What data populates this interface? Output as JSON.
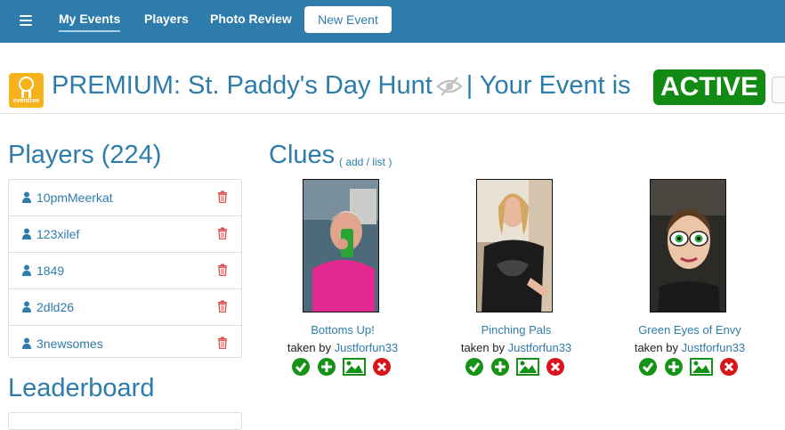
{
  "nav": {
    "items": [
      {
        "label": "My Events",
        "active": true
      },
      {
        "label": "Players",
        "active": false
      },
      {
        "label": "Photo Review",
        "active": false
      }
    ],
    "new_event_label": "New Event"
  },
  "header": {
    "logo_text": "eventzee",
    "title_prefix": "PREMIUM: St. Paddy's Day Hunt",
    "title_suffix": "| Your Event is",
    "status": "ACTIVE"
  },
  "players": {
    "heading": "Players (224)",
    "items": [
      {
        "name": "10pmMeerkat"
      },
      {
        "name": "123xilef"
      },
      {
        "name": "1849"
      },
      {
        "name": "2dld26"
      },
      {
        "name": "3newsomes"
      }
    ]
  },
  "clues": {
    "heading": "Clues",
    "sub_links": "( add / list )",
    "items": [
      {
        "title": "Bottoms Up!",
        "taken_prefix": "taken by",
        "user": "Justforfun33"
      },
      {
        "title": "Pinching Pals",
        "taken_prefix": "taken by",
        "user": "Justforfun33"
      },
      {
        "title": "Green Eyes of Envy",
        "taken_prefix": "taken by",
        "user": "Justforfun33"
      }
    ]
  },
  "leaderboard": {
    "heading": "Leaderboard"
  },
  "colors": {
    "nav_bg": "#2d7cab",
    "link": "#2d7cab",
    "active_badge": "#138a13",
    "approve": "#169316",
    "reject": "#d8151c",
    "trash": "#d9534f"
  },
  "icons": {
    "menu": "hamburger-icon",
    "visibility": "eye-slash-icon",
    "player": "user-icon",
    "delete": "trash-icon",
    "approve": "check-circle-icon",
    "add": "plus-circle-icon",
    "photo": "image-icon",
    "reject": "times-circle-icon"
  }
}
